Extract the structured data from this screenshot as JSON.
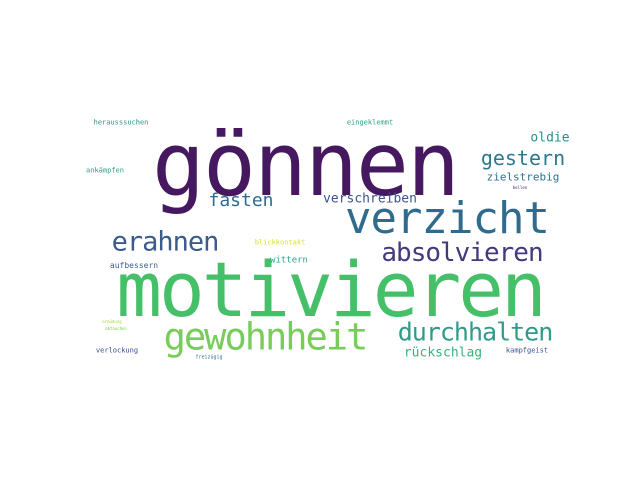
{
  "wordcloud": {
    "words": [
      {
        "text": "gönnen",
        "color": "#46185f"
      },
      {
        "text": "motivieren",
        "color": "#46c068"
      },
      {
        "text": "verzicht",
        "color": "#2f6b8e"
      },
      {
        "text": "gewohnheit",
        "color": "#78cc5a"
      },
      {
        "text": "durchhalten",
        "color": "#2f9b89"
      },
      {
        "text": "absolvieren",
        "color": "#433a7d"
      },
      {
        "text": "erahnen",
        "color": "#3b5b8c"
      },
      {
        "text": "gestern",
        "color": "#2a798d"
      },
      {
        "text": "fasten",
        "color": "#306a8e"
      },
      {
        "text": "verschreiben",
        "color": "#3b558c"
      },
      {
        "text": "oldie",
        "color": "#2a8e8a"
      },
      {
        "text": "zielstrebig",
        "color": "#2c728e"
      },
      {
        "text": "rückschlag",
        "color": "#3bb27a"
      },
      {
        "text": "aufbessern",
        "color": "#3a5e8c"
      },
      {
        "text": "wittern",
        "color": "#2ea38a"
      },
      {
        "text": "blickkontakt",
        "color": "#d8e22e"
      },
      {
        "text": "herausssuchen",
        "color": "#2d9289"
      },
      {
        "text": "eingeklemmt",
        "color": "#2e9f87"
      },
      {
        "text": "ankämpfen",
        "color": "#2aa083"
      },
      {
        "text": "verlockung",
        "color": "#3c4d8a"
      },
      {
        "text": "kampfgeist",
        "color": "#3b508b"
      },
      {
        "text": "freizügig",
        "color": "#2e6d8e"
      },
      {
        "text": "bellen",
        "color": "#482475"
      },
      {
        "text": "ermüdung",
        "color": "#9fd938"
      },
      {
        "text": "abtauchen",
        "color": "#7ad151"
      }
    ]
  }
}
